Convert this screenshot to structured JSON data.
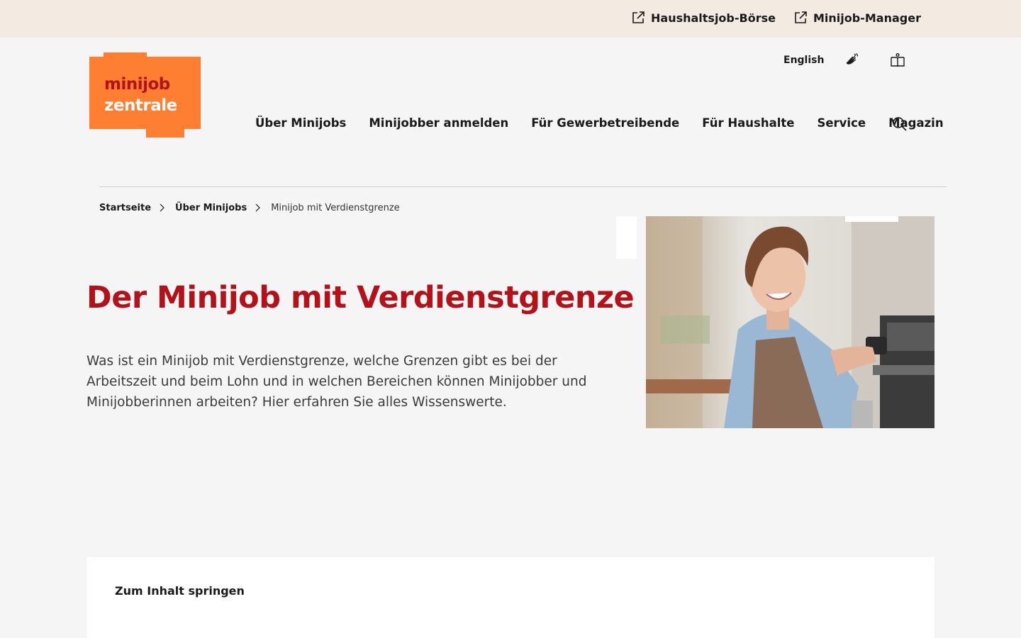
{
  "topbar": {
    "links": [
      {
        "label": "Haushaltsjob-Börse",
        "icon": "external-link-icon"
      },
      {
        "label": "Minijob-Manager",
        "icon": "external-link-icon"
      }
    ]
  },
  "logo": {
    "line1": "minijob",
    "line2": "zentrale",
    "color_bg": "#ff7f32",
    "color_text": "#b3121b"
  },
  "utility_nav": {
    "language": "English",
    "sign_language_icon": "sign-language-icon",
    "easy_language_icon": "easy-language-book-icon"
  },
  "main_nav": {
    "items": [
      "Über Minijobs",
      "Minijobber anmelden",
      "Für Gewerbetreibende",
      "Für Haushalte",
      "Service",
      "Magazin"
    ],
    "search_icon": "search-icon"
  },
  "breadcrumb": {
    "items": [
      "Startseite",
      "Über Minijobs"
    ],
    "current": "Minijob mit Verdienstgrenze"
  },
  "hero": {
    "title": "Der Minijob mit Verdienstgrenze",
    "intro": "Was ist ein Minijob mit Verdienstgrenze, welche Grenzen gibt es bei der Arbeitszeit und beim Lohn und in welchen Bereichen können Minijobber und Minijobberinnen arbeiten? Hier erfahren Sie alles Wissenswerte."
  },
  "content": {
    "skip_label": "Zum Inhalt springen"
  },
  "colors": {
    "accent_red": "#b3121b",
    "brand_orange": "#ff7f32",
    "topbar_bg": "#f3ebe2",
    "page_bg": "#f5f5f5"
  }
}
